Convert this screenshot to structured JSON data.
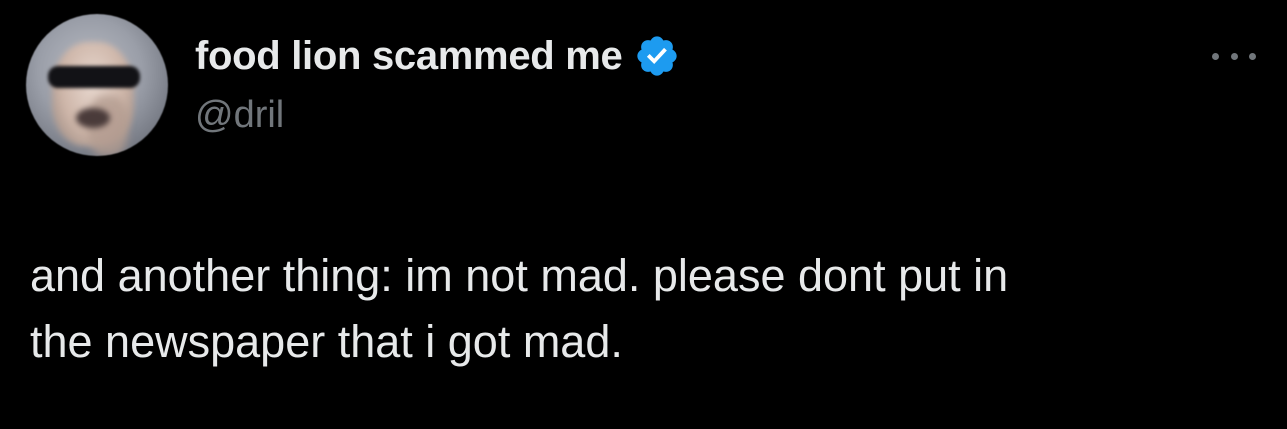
{
  "author": {
    "display_name": "food lion scammed me",
    "handle": "@dril",
    "verified_icon": "verified-badge-icon",
    "avatar": "profile-photo"
  },
  "tweet": {
    "text_line_1": "and another thing: im not mad. please dont put in",
    "text_line_2": "the newspaper that i got mad."
  },
  "actions": {
    "more_icon": "more-options-icon"
  },
  "colors": {
    "background": "#000000",
    "primary_text": "#e7e9ea",
    "secondary_text": "#71767b",
    "verified_blue": "#1d9bf0"
  }
}
